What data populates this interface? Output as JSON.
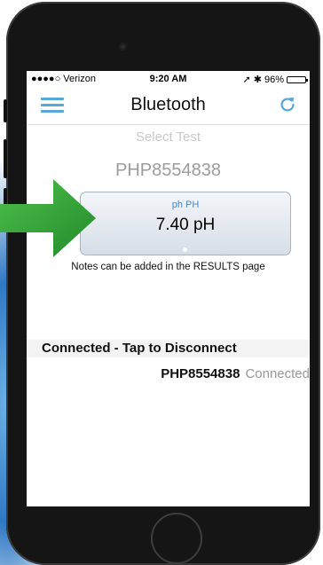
{
  "status_bar": {
    "carrier": "●●●●○ Verizon",
    "time": "9:20 AM",
    "battery": "96%",
    "battery_level": 0.96
  },
  "navbar": {
    "title": "Bluetooth",
    "menu_icon": "hamburger-menu-icon",
    "refresh_icon": "refresh-icon"
  },
  "content": {
    "select_test": "Select Test",
    "device_title": "PHP8554838",
    "test_card": {
      "name": "ph PH",
      "value": "7.40 pH"
    },
    "notes_hint": "Notes can be added in the RESULTS page"
  },
  "connection": {
    "header": "Connected - Tap to Disconnect",
    "device_name": "PHP8554838",
    "device_status": "Connected"
  },
  "colors": {
    "accent": "#56a8d8",
    "arrow": "#37a33d",
    "muted": "#9c9c9c"
  }
}
